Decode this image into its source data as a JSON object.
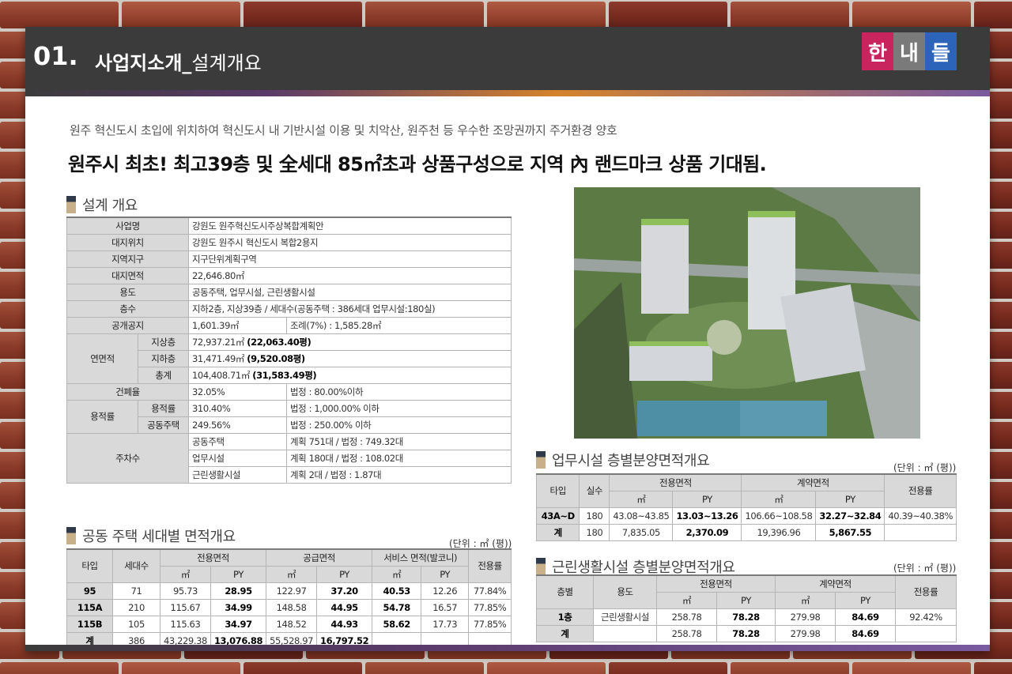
{
  "header": {
    "number": "01.",
    "title": "사업지소개_",
    "subtitle": "설계개요"
  },
  "logo": {
    "chars": [
      "한",
      "내",
      "들"
    ],
    "colors": [
      "#c8245e",
      "#7a7a7a",
      "#2b64b8"
    ]
  },
  "intro": "원주 혁신도시 초입에 위치하여 혁신도시 내 기반시설 이용 및 치악산, 원주천 등 우수한 조망권까지 주거환경 양호",
  "headline": "원주시 최초!  최고39층 및 全세대 85㎡초과 상품구성으로 지역 內 랜드마크 상품 기대됨.",
  "design": {
    "title": "설계 개요",
    "project_label": "사업명",
    "project": "강원도 원주혁신도시주상복합계획안",
    "location_label": "대지위치",
    "location": "강원도 원주시 혁신도시 복합2용지",
    "zone_label": "지역지구",
    "zone": "지구단위계획구역",
    "site_area_label": "대지면적",
    "site_area": "22,646.80㎡",
    "use_label": "용도",
    "use": "공동주택, 업무시설, 근린생활시설",
    "floors_label": "층수",
    "floors": "지하2층, 지상39층 / 세대수(공동주택 : 386세대 업무시설:180실)",
    "open_space_label": "공개공지",
    "open_space": "1,601.39㎡",
    "open_space_ordinance": "조례(7%) : 1,585.28㎡",
    "gfa_label": "연면적",
    "above_label": "지상층",
    "above_value": "72,937.21㎡",
    "above_py": "(22,063.40평)",
    "below_label": "지하층",
    "below_value": "31,471.49㎡",
    "below_py": "(9,520.08평)",
    "total_label": "총계",
    "total_value": "104,408.71㎡",
    "total_py": "(31,583.49평)",
    "bcr_label": "건폐율",
    "bcr": "32.05%",
    "bcr_legal": "법정 : 80.00%이하",
    "far_label": "용적률",
    "far_label_1": "용적률",
    "far_1": "310.40%",
    "far_1_legal": "법정 : 1,000.00% 이하",
    "far_label_2": "공동주택",
    "far_2": "249.56%",
    "far_2_legal": "법정 : 250.00% 이하",
    "parking_label": "주차수",
    "parking_1_label": "공동주택",
    "parking_1": "계획 751대 / 법정 : 749.32대",
    "parking_2_label": "업무시설",
    "parking_2": "계획 180대 / 법정 : 108.02대",
    "parking_3_label": "근린생활시설",
    "parking_3": "계획 2대 / 법정 : 1.87대"
  },
  "housing": {
    "title": "공동 주택 세대별 면적개요",
    "unit": "(단위 : ㎡ (평))",
    "h_type": "타입",
    "h_households": "세대수",
    "h_exclusive": "전용면적",
    "h_supply": "공급면적",
    "h_service": "서비스 면적(발코니)",
    "h_ratio": "전용률",
    "h_m2": "㎡",
    "h_py": "PY",
    "rows": [
      {
        "type": "95",
        "hh": "71",
        "ex_m2": "95.73",
        "ex_py": "28.95",
        "sp_m2": "122.97",
        "sp_py": "37.20",
        "sv_m2": "40.53",
        "sv_py": "12.26",
        "ratio": "77.84%"
      },
      {
        "type": "115A",
        "hh": "210",
        "ex_m2": "115.67",
        "ex_py": "34.99",
        "sp_m2": "148.58",
        "sp_py": "44.95",
        "sv_m2": "54.78",
        "sv_py": "16.57",
        "ratio": "77.85%"
      },
      {
        "type": "115B",
        "hh": "105",
        "ex_m2": "115.63",
        "ex_py": "34.97",
        "sp_m2": "148.52",
        "sp_py": "44.93",
        "sv_m2": "58.62",
        "sv_py": "17.73",
        "ratio": "77.85%"
      },
      {
        "type": "계",
        "hh": "386",
        "ex_m2": "43,229.38",
        "ex_py": "13,076.88",
        "sp_m2": "55,528.97",
        "sp_py": "16,797.52",
        "sv_m2": "",
        "sv_py": "",
        "ratio": ""
      }
    ]
  },
  "office": {
    "title": "업무시설 층별분양면적개요",
    "unit": "(단위 : ㎡ (평))",
    "h_type": "타입",
    "h_rooms": "실수",
    "h_exclusive": "전용면적",
    "h_contract": "계약면적",
    "h_ratio": "전용률",
    "h_m2": "㎡",
    "h_py": "PY",
    "rows": [
      {
        "type": "43A~D",
        "rooms": "180",
        "ex_m2": "43.08~43.85",
        "ex_py": "13.03~13.26",
        "ct_m2": "106.66~108.58",
        "ct_py": "32.27~32.84",
        "ratio": "40.39~40.38%"
      },
      {
        "type": "계",
        "rooms": "180",
        "ex_m2": "7,835.05",
        "ex_py": "2,370.09",
        "ct_m2": "19,396.96",
        "ct_py": "5,867.55",
        "ratio": ""
      }
    ]
  },
  "retail": {
    "title": "근린생활시설 층별분양면적개요",
    "unit": "(단위 : ㎡ (평))",
    "h_floor": "층별",
    "h_use": "용도",
    "h_exclusive": "전용면적",
    "h_contract": "계약면적",
    "h_ratio": "전용률",
    "h_m2": "㎡",
    "h_py": "PY",
    "rows": [
      {
        "floor": "1층",
        "use": "근린생활시설",
        "ex_m2": "258.78",
        "ex_py": "78.28",
        "ct_m2": "279.98",
        "ct_py": "84.69",
        "ratio": "92.42%"
      },
      {
        "floor": "계",
        "use": "",
        "ex_m2": "258.78",
        "ex_py": "78.28",
        "ct_m2": "279.98",
        "ct_py": "84.69",
        "ratio": ""
      }
    ]
  }
}
